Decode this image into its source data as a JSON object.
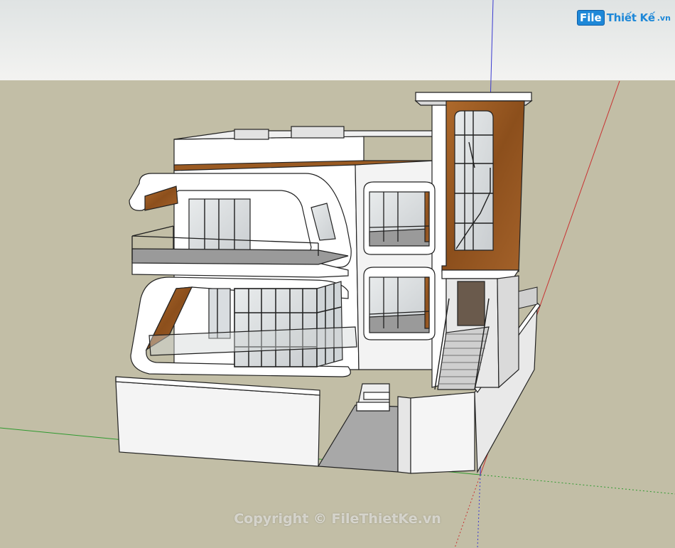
{
  "logo": {
    "badge": "File",
    "name": "Thiết Kế",
    "tld": ".vn"
  },
  "watermark": {
    "text": "Copyright © FileThietKe.vn"
  },
  "colors": {
    "sky": "#ebeeee",
    "ground": "#c2bea6",
    "wall": "#ffffff",
    "wall_shade": "#dcdcdc",
    "wood": "#9a5a22",
    "glass": "#d9dde0",
    "frame": "#1e1e1e",
    "axis_red": "#c83232",
    "axis_green": "#2f9a2f",
    "axis_blue": "#3a3ad0"
  }
}
